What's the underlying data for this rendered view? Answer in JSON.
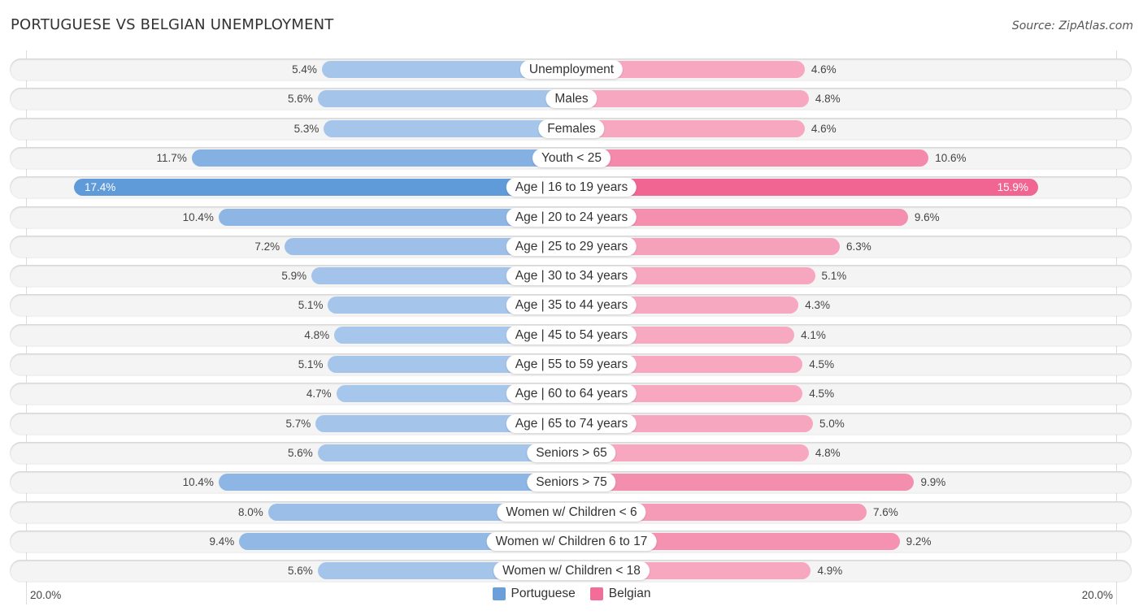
{
  "header": {
    "title": "PORTUGUESE VS BELGIAN UNEMPLOYMENT",
    "source": "Source: ZipAtlas.com"
  },
  "axis": {
    "left_label": "20.0%",
    "right_label": "20.0%"
  },
  "legend": {
    "items": [
      {
        "label": "Portuguese",
        "color": "#6a9fdc"
      },
      {
        "label": "Belgian",
        "color": "#f26d98"
      }
    ]
  },
  "colors": {
    "portuguese_light": "#a9c7eb",
    "portuguese_strong": "#5f9ad9",
    "belgian_light": "#f7a9c1",
    "belgian_strong": "#f06592"
  },
  "chart_data": {
    "type": "bar",
    "orientation": "horizontal-diverging",
    "title": "PORTUGUESE VS BELGIAN UNEMPLOYMENT",
    "xlabel": "",
    "ylabel": "",
    "xlim": [
      -20,
      20
    ],
    "unit": "%",
    "legend_position": "bottom-center",
    "grid": false,
    "categories": [
      "Unemployment",
      "Males",
      "Females",
      "Youth < 25",
      "Age | 16 to 19 years",
      "Age | 20 to 24 years",
      "Age | 25 to 29 years",
      "Age | 30 to 34 years",
      "Age | 35 to 44 years",
      "Age | 45 to 54 years",
      "Age | 55 to 59 years",
      "Age | 60 to 64 years",
      "Age | 65 to 74 years",
      "Seniors > 65",
      "Seniors > 75",
      "Women w/ Children < 6",
      "Women w/ Children 6 to 17",
      "Women w/ Children < 18"
    ],
    "series": [
      {
        "name": "Portuguese",
        "side": "left",
        "values": [
          5.4,
          5.6,
          5.3,
          11.7,
          17.4,
          10.4,
          7.2,
          5.9,
          5.1,
          4.8,
          5.1,
          4.7,
          5.7,
          5.6,
          10.4,
          8.0,
          9.4,
          5.6
        ],
        "labels": [
          "5.4%",
          "5.6%",
          "5.3%",
          "11.7%",
          "17.4%",
          "10.4%",
          "7.2%",
          "5.9%",
          "5.1%",
          "4.8%",
          "5.1%",
          "4.7%",
          "5.7%",
          "5.6%",
          "10.4%",
          "8.0%",
          "9.4%",
          "5.6%"
        ]
      },
      {
        "name": "Belgian",
        "side": "right",
        "values": [
          4.6,
          4.8,
          4.6,
          10.6,
          15.9,
          9.6,
          6.3,
          5.1,
          4.3,
          4.1,
          4.5,
          4.5,
          5.0,
          4.8,
          9.9,
          7.6,
          9.2,
          4.9
        ],
        "labels": [
          "4.6%",
          "4.8%",
          "4.6%",
          "10.6%",
          "15.9%",
          "9.6%",
          "6.3%",
          "5.1%",
          "4.3%",
          "4.1%",
          "4.5%",
          "4.5%",
          "5.0%",
          "4.8%",
          "9.9%",
          "7.6%",
          "9.2%",
          "4.9%"
        ]
      }
    ]
  }
}
